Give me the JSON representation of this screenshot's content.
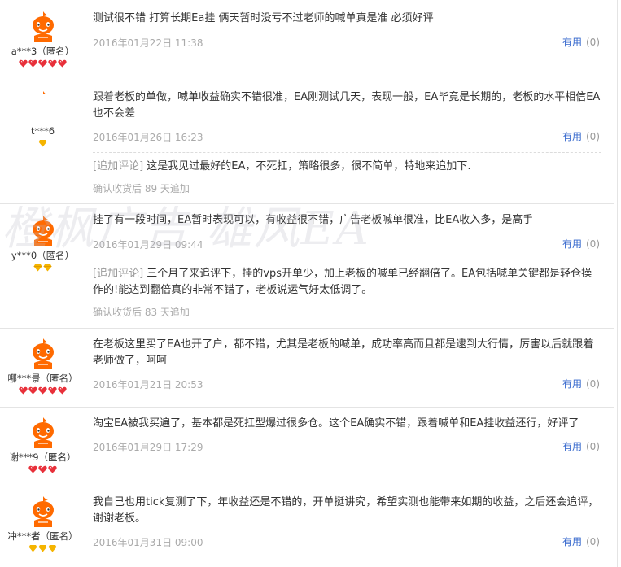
{
  "watermark": "橙枫广告 雄风EA",
  "useful_label": "有用",
  "reviews": [
    {
      "user": "a***3（匿名）",
      "rank": "red",
      "rank_count": 5,
      "text": "测试很不错 打算长期Ea挂 俩天暂时没亏不过老师的喊单真是准 必须好评",
      "date": "2016年01月22日 11:38",
      "useful": "(0)"
    },
    {
      "user": "t***6",
      "rank": "gold",
      "rank_count": 1,
      "text": "跟着老板的单做，喊单收益确实不错很准，EA刚测试几天，表现一般，EA毕竟是长期的，老板的水平相信EA也不会差",
      "date": "2016年01月26日 16:23",
      "useful": "(0)",
      "append_tag": "[追加评论]",
      "append_text": "这是我见过最好的EA，不死扛，策略很多，很不简单，特地来追加下.",
      "confirm": "确认收货后 89 天追加"
    },
    {
      "user": "y***0（匿名）",
      "rank": "gold",
      "rank_count": 2,
      "text": "挂了有一段时间，EA暂时表现可以，有收益很不错，广告老板喊单很准，比EA收入多，是高手",
      "date": "2016年01月29日 09:44",
      "useful": "(0)",
      "append_tag": "[追加评论]",
      "append_text": "三个月了来追评下，挂的vps开单少，加上老板的喊单已经翻倍了。EA包括喊单关键都是轻仓操作的!能达到翻倍真的非常不错了，老板说运气好太低调了。",
      "confirm": "确认收货后 83 天追加"
    },
    {
      "user": "哪***景（匿名）",
      "rank": "red",
      "rank_count": 5,
      "text": "在老板这里买了EA也开了户，都不错，尤其是老板的喊单，成功率高而且都是逮到大行情，厉害以后就跟着老师做了，呵呵",
      "date": "2016年01月21日 20:53",
      "useful": "(0)"
    },
    {
      "user": "谢***9（匿名）",
      "rank": "red",
      "rank_count": 3,
      "text": "淘宝EA被我买遍了，基本都是死扛型爆过很多仓。这个EA确实不错，跟着喊单和EA挂收益还行，好评了",
      "date": "2016年01月29日 17:29",
      "useful": "(0)"
    },
    {
      "user": "冲***者（匿名）",
      "rank": "gold",
      "rank_count": 3,
      "text": "我自己也用tick复测了下，年收益还是不错的，开单挺讲究，希望实测也能带来如期的收益，之后还会追评，谢谢老板。",
      "date": "2016年01月31日 09:00",
      "useful": "(0)"
    }
  ]
}
